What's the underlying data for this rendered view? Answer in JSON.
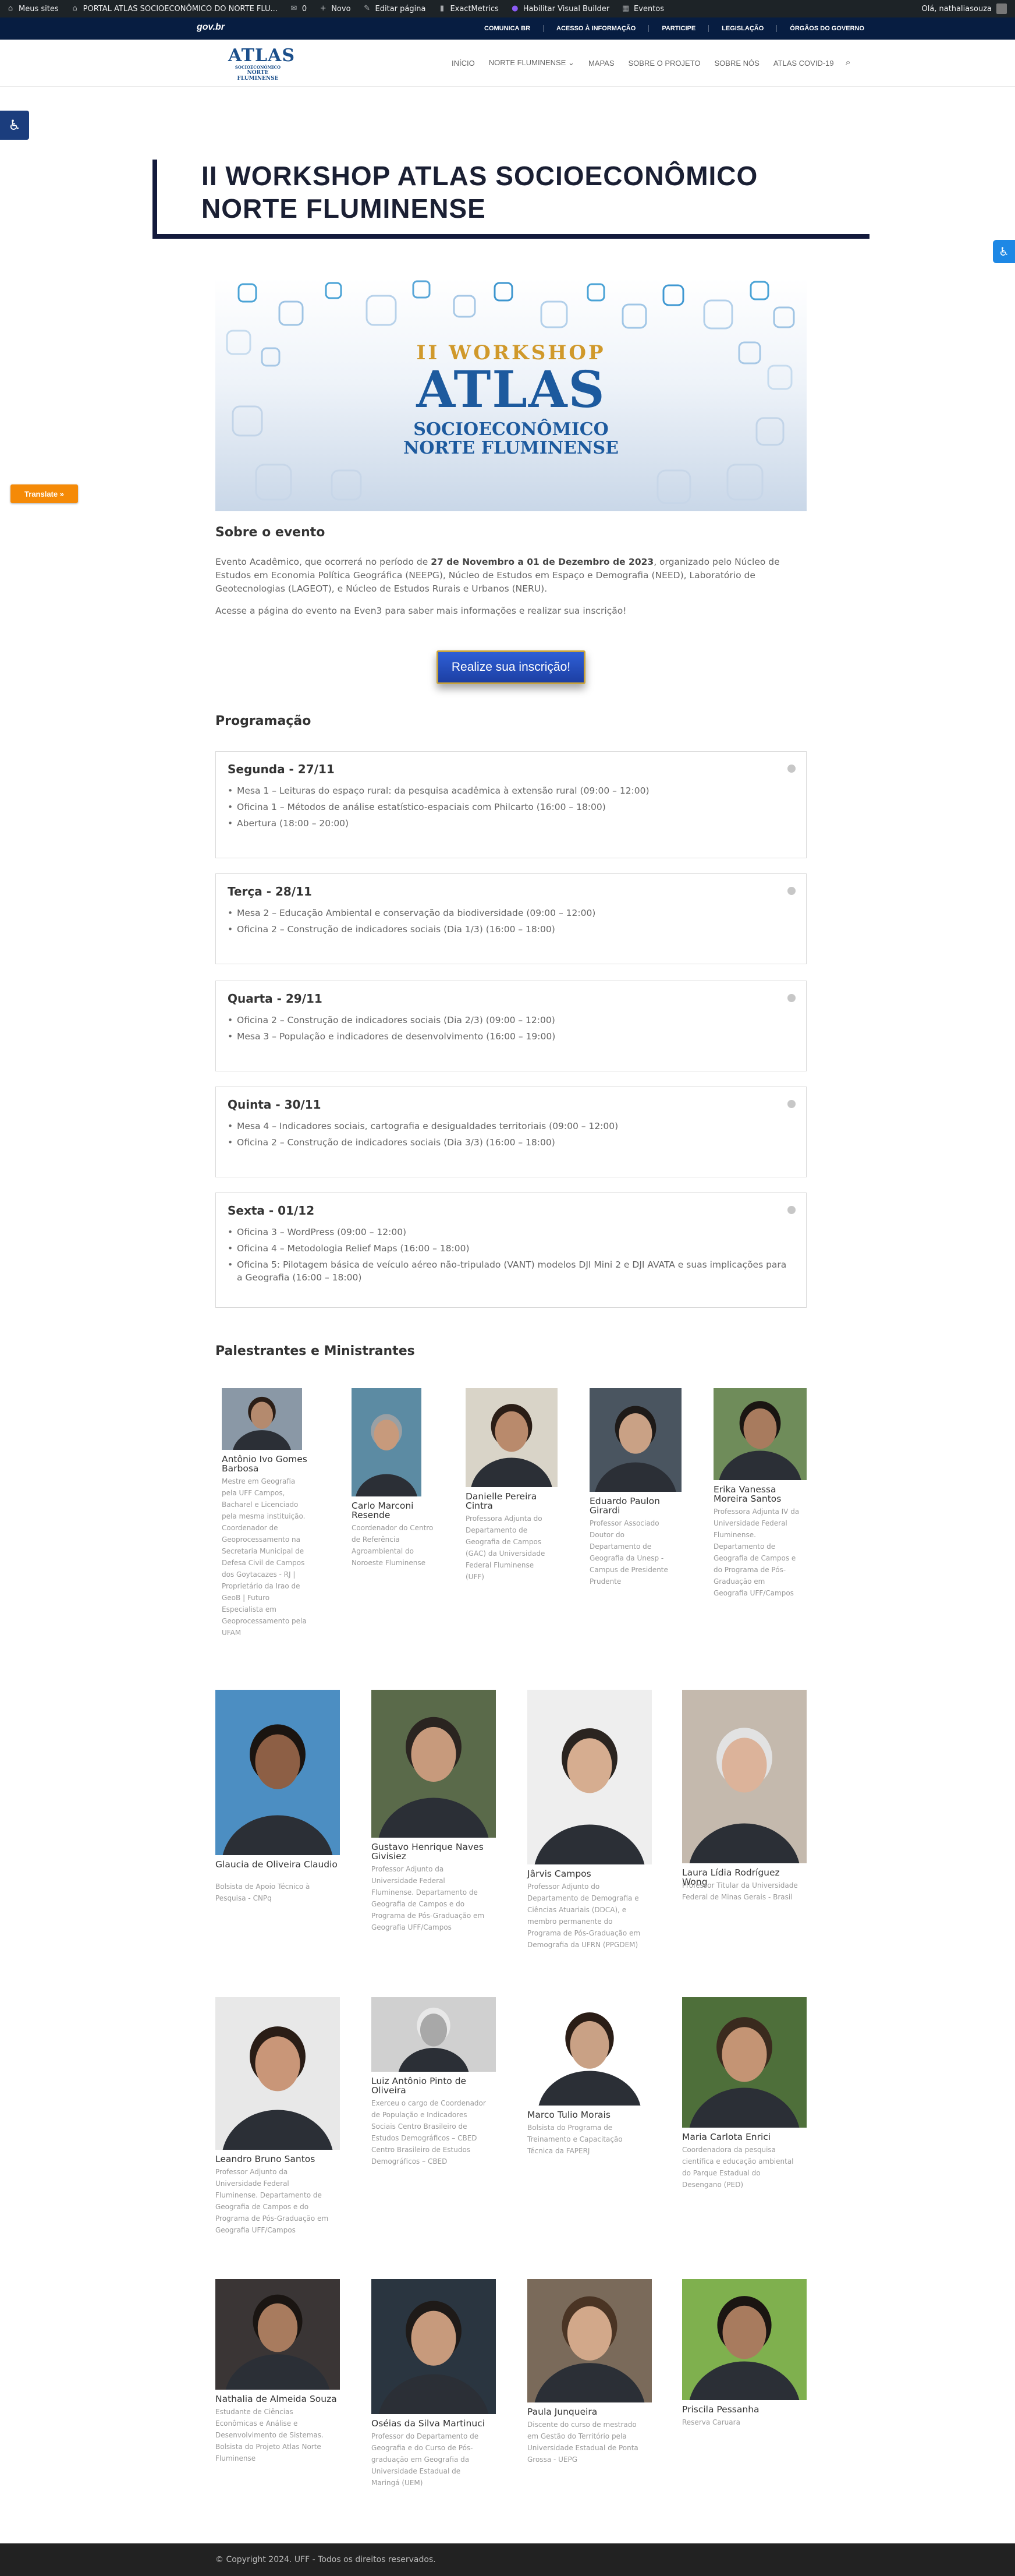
{
  "adminbar": {
    "items": [
      "Meus sites",
      "PORTAL ATLAS SOCIOECONÔMICO DO NORTE FLU...",
      "0",
      "Novo",
      "Editar página",
      "ExactMetrics",
      "Habilitar Visual Builder",
      "Eventos"
    ],
    "greeting": "Olá, nathaliasouza"
  },
  "govbar": {
    "logo": "gov.br",
    "links": [
      "COMUNICA BR",
      "ACESSO À INFORMAÇÃO",
      "PARTICIPE",
      "LEGISLAÇÃO",
      "ÓRGÃOS DO GOVERNO"
    ]
  },
  "site": {
    "logo_l1": "ATLAS",
    "logo_l2": "SOCIOECONÔMICO",
    "logo_l3": "NORTE FLUMINENSE",
    "nav": [
      "INÍCIO",
      "NORTE FLUMINENSE",
      "MAPAS",
      "SOBRE O PROJETO",
      "SOBRE NÓS",
      "ATLAS COVID-19"
    ],
    "nav_dropdown_caret": "⌄"
  },
  "floating": {
    "translate": "Translate »"
  },
  "page": {
    "title": "II WORKSHOP ATLAS SOCIOECONÔMICO NORTE FLUMINENSE"
  },
  "banner": {
    "line1": "II WORKSHOP",
    "line2": "ATLAS",
    "line3": "SOCIOECONÔMICO",
    "line4": "NORTE FLUMINENSE"
  },
  "about": {
    "heading": "Sobre o evento",
    "p1_a": "Evento Acadêmico, que ocorrerá no período de ",
    "p1_b": "27 de Novembro a 01 de Dezembro de 2023",
    "p1_c": ", organizado pelo Núcleo de Estudos em Economia Política Geográfica (NEEPG), Núcleo de Estudos em Espaço e Demografia (NEED), Laboratório de Geotecnologias (LAGEOT), e Núcleo de Estudos Rurais e Urbanos (NERU).",
    "p2": "Acesse a página do evento na Even3 para saber mais informações e realizar sua inscrição!",
    "cta": "Realize sua inscrição!"
  },
  "programacao": {
    "heading": "Programação",
    "days": [
      {
        "title": "Segunda - 27/11",
        "items": [
          "Mesa 1 – Leituras do espaço rural: da pesquisa acadêmica à extensão rural (09:00 – 12:00)",
          "Oficina 1 – Métodos de análise estatístico-espaciais com Philcarto (16:00 – 18:00)",
          "Abertura (18:00 – 20:00)"
        ]
      },
      {
        "title": "Terça - 28/11",
        "items": [
          "Mesa 2 – Educação Ambiental e conservação da biodiversidade (09:00 – 12:00)",
          "Oficina 2 – Construção de indicadores sociais (Dia 1/3) (16:00 – 18:00)"
        ]
      },
      {
        "title": "Quarta - 29/11",
        "items": [
          "Oficina 2 – Construção de indicadores sociais (Dia 2/3) (09:00 – 12:00)",
          "Mesa 3 – População e indicadores de desenvolvimento (16:00 – 19:00)"
        ]
      },
      {
        "title": "Quinta - 30/11",
        "items": [
          "Mesa 4 – Indicadores sociais, cartografia e desigualdades territoriais (09:00 – 12:00)",
          "Oficina 2 – Construção de indicadores sociais (Dia 3/3) (16:00 – 18:00)"
        ]
      },
      {
        "title": "Sexta - 01/12",
        "items": [
          "Oficina 3 – WordPress (09:00 – 12:00)",
          "Oficina 4 – Metodologia Relief Maps (16:00 – 18:00)",
          "Oficina 5: Pilotagem básica de veículo aéreo não-tripulado (VANT) modelos DJI Mini 2 e DJI AVATA e suas implicações para a Geografia (16:00 – 18:00)"
        ]
      }
    ]
  },
  "speakers": {
    "heading": "Palestrantes e Ministrantes",
    "people": [
      {
        "name": "Antônio Ivo Gomes Barbosa",
        "desc": "Mestre em Geografia pela UFF Campos, Bacharel e Licenciado pela mesma instituição. Coordenador de Geoprocessamento na Secretaria Municipal de Defesa Civil de Campos dos Goytacazes - RJ | Proprietário da Irao de GeoB | Futuro Especialista em Geoprocessamento pela UFAM",
        "skin": "#b48a6e",
        "bg": "#8a98a6",
        "hair": "#2a1d16"
      },
      {
        "name": "Carlo Marconi Resende",
        "desc": "Coordenador do Centro de Referência Agroambiental do Noroeste Fluminense",
        "skin": "#c79a7c",
        "bg": "#5c8ba3",
        "hair": "#9aa0a4"
      },
      {
        "name": "Danielle Pereira Cintra",
        "desc": "Professora Adjunta do Departamento de Geografia de Campos (GAC) da Universidade Federal Fluminense (UFF)",
        "skin": "#b98a6c",
        "bg": "#d9d4c8",
        "hair": "#2a1d16"
      },
      {
        "name": "Eduardo Paulon Girardi",
        "desc": "Professor Associado Doutor do Departamento de Geografia da Unesp - Campus de Presidente Prudente",
        "skin": "#c9a185",
        "bg": "#4a5560",
        "hair": "#1e1a18"
      },
      {
        "name": "Erika Vanessa Moreira Santos",
        "desc": "Professora Adjunta IV da Universidade Federal Fluminense. Departamento de Geografia de Campos e do Programa de Pós-Graduação em Geografia UFF/Campos",
        "skin": "#a87b5e",
        "bg": "#6f8c5a",
        "hair": "#1a1512"
      },
      {
        "name": "Glaucia de Oliveira Claudio",
        "desc": "Bolsista de Apoio Técnico à Pesquisa - CNPq",
        "skin": "#8d5f45",
        "bg": "#4c8ec2",
        "hair": "#1a1410"
      },
      {
        "name": "Gustavo Henrique Naves Givisiez",
        "desc": "Professor Adjunto da Universidade Federal Fluminense. Departamento de Geografia de Campos e do Programa de Pós-Graduação em Geografia UFF/Campos",
        "skin": "#c79a7c",
        "bg": "#5a6a4a",
        "hair": "#2a2420"
      },
      {
        "name": "Jârvis Campos",
        "desc": "Professor Adjunto do Departamento de Demografia e Ciências Atuariais (DDCA), e membro permanente do Programa de Pós-Graduação em Demografia da UFRN (PPGDEM)",
        "skin": "#d6ad90",
        "bg": "#eeeeee",
        "hair": "#2a2420"
      },
      {
        "name": "Laura Lídia Rodríguez Wong",
        "desc": "Professor Titular da Universidade Federal de Minas Gerais - Brasil",
        "skin": "#dcb39a",
        "bg": "#c4b9ad",
        "hair": "#e2e2e2"
      },
      {
        "name": "Leandro Bruno Santos",
        "desc": "Professor Adjunto da Universidade Federal Fluminense. Departamento de Geografia de Campos e do Programa de Pós-Graduação em Geografia UFF/Campos",
        "skin": "#c99678",
        "bg": "#e8e8e8",
        "hair": "#2a1d16"
      },
      {
        "name": "Luiz Antônio Pinto de Oliveira",
        "desc": "Exerceu o cargo de Coordenador de População e Indicadores Sociais Centro Brasileiro de Estudos Demográficos – CBED Centro Brasileiro de Estudos Demográficos – CBED",
        "skin": "#a8a8a8",
        "bg": "#d0d0d0",
        "hair": "#e8e8e8"
      },
      {
        "name": "Marco Tulio Morais",
        "desc": "Bolsista do Programa de Treinamento e Capacitação Técnica da FAPERJ",
        "skin": "#c9a185",
        "bg": "#ffffff",
        "hair": "#2a1d16"
      },
      {
        "name": "Maria Carlota Enrici",
        "desc": "Coordenadora da pesquisa científica e educação ambiental do Parque Estadual do Desengano (PED)",
        "skin": "#c49474",
        "bg": "#4e6f3a",
        "hair": "#3a2a1e"
      },
      {
        "name": "Nathalia de Almeida Souza",
        "desc": "Estudante de Ciências Econômicas e Análise e Desenvolvimento de Sistemas. Bolsista do Projeto Atlas Norte Fluminense",
        "skin": "#a87b5e",
        "bg": "#3a3535",
        "hair": "#1a1512"
      },
      {
        "name": "Oséias da Silva Martinuci",
        "desc": "Professor do Departamento de Geografia e do Curso de Pós-graduação em Geografia da Universidade Estadual de Maringá (UEM)",
        "skin": "#c79a7c",
        "bg": "#2a3540",
        "hair": "#1e1a18"
      },
      {
        "name": "Paula Junqueira",
        "desc": "Discente do curso de mestrado em Gestão do Território pela Universidade Estadual de Ponta Grossa - UEPG",
        "skin": "#d2a88a",
        "bg": "#7a6a5a",
        "hair": "#4a3424"
      },
      {
        "name": "Priscila Pessanha",
        "desc": "Reserva Caruara",
        "skin": "#a87b5e",
        "bg": "#7fb04e",
        "hair": "#1a1512"
      }
    ]
  },
  "footer": {
    "text": "© Copyright 2024. UFF - Todos os direitos reservados."
  },
  "colors": {
    "admin_bg": "#1d2327",
    "gov_bg": "#071d41",
    "title_border": "#131a3c",
    "cta": "#2e5fd6",
    "translate": "#f58a07"
  }
}
